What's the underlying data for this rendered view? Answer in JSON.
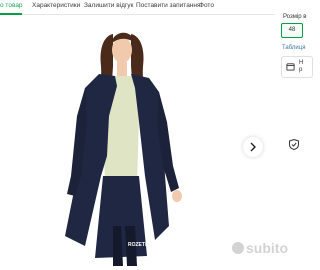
{
  "tabs": [
    {
      "label": "о товар",
      "active": true
    },
    {
      "label": "Характеристики",
      "active": false
    },
    {
      "label": "Залишити відгук",
      "active": false
    },
    {
      "label": "Поставити запитання",
      "active": false
    },
    {
      "label": "Фото",
      "active": false
    }
  ],
  "side": {
    "size_label": "Розмір в",
    "selected_size": "48",
    "size_table": "Таблиця",
    "info_line1": "Н",
    "info_line2": "р"
  },
  "photo": {
    "brand_tag": "ROZETKA"
  },
  "watermark": "subito",
  "colors": {
    "accent": "#00a046",
    "coat": "#1f2742",
    "top": "#dfe5c4",
    "skin": "#f1c9ad",
    "hair": "#4a2a1a",
    "link": "#3e77aa"
  },
  "icons": {
    "next": "chevron-right-icon",
    "box": "box-icon",
    "shield": "shield-icon"
  }
}
